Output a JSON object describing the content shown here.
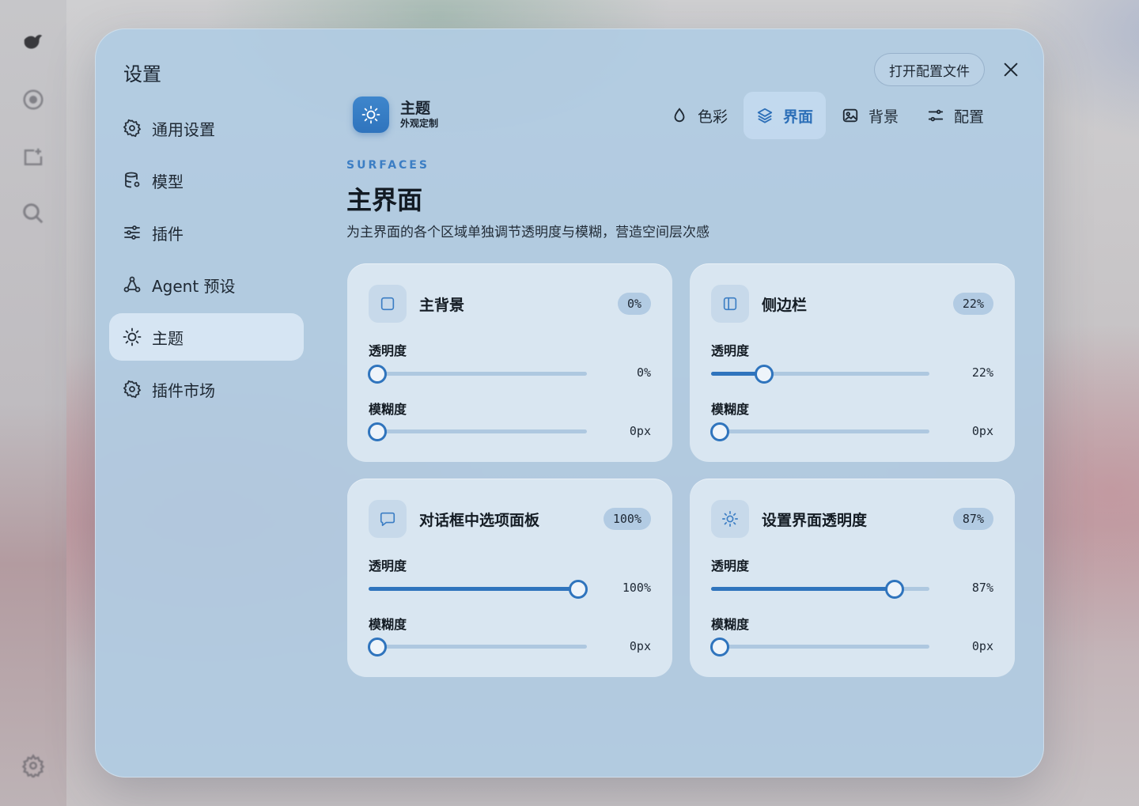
{
  "rail": {
    "icons": [
      "app-logo-icon",
      "record-icon",
      "new-chat-icon",
      "search-icon",
      "settings-icon"
    ]
  },
  "dialog": {
    "title": "设置",
    "open_config_label": "打开配置文件",
    "close_icon": "close-icon"
  },
  "sidebar": {
    "items": [
      {
        "label": "通用设置",
        "icon": "gear-icon",
        "active": false
      },
      {
        "label": "模型",
        "icon": "database-icon",
        "active": false
      },
      {
        "label": "插件",
        "icon": "sliders-icon",
        "active": false
      },
      {
        "label": "Agent 预设",
        "icon": "agent-icon",
        "active": false
      },
      {
        "label": "主题",
        "icon": "sun-icon",
        "active": true
      },
      {
        "label": "插件市场",
        "icon": "gear-icon",
        "active": false
      }
    ]
  },
  "theme_header": {
    "name": "主题",
    "subtitle": "外观定制"
  },
  "tabs": [
    {
      "label": "色彩",
      "icon": "droplet-icon",
      "active": false
    },
    {
      "label": "界面",
      "icon": "layers-icon",
      "active": true
    },
    {
      "label": "背景",
      "icon": "image-icon",
      "active": false
    },
    {
      "label": "配置",
      "icon": "sliders-icon",
      "active": false
    }
  ],
  "section": {
    "eyebrow": "SURFACES",
    "title": "主界面",
    "description": "为主界面的各个区域单独调节透明度与模糊，营造空间层次感"
  },
  "cards": [
    {
      "title": "主背景",
      "icon": "square-icon",
      "badge": "0%",
      "opacity_label": "透明度",
      "opacity_value": "0%",
      "opacity_fraction": 0.0,
      "blur_label": "模糊度",
      "blur_value": "0px",
      "blur_fraction": 0.0
    },
    {
      "title": "侧边栏",
      "icon": "sidebar-icon",
      "badge": "22%",
      "opacity_label": "透明度",
      "opacity_value": "22%",
      "opacity_fraction": 0.22,
      "blur_label": "模糊度",
      "blur_value": "0px",
      "blur_fraction": 0.0
    },
    {
      "title": "对话框中选项面板",
      "icon": "chat-bubble-icon",
      "badge": "100%",
      "opacity_label": "透明度",
      "opacity_value": "100%",
      "opacity_fraction": 1.0,
      "blur_label": "模糊度",
      "blur_value": "0px",
      "blur_fraction": 0.0
    },
    {
      "title": "设置界面透明度",
      "icon": "sun-icon",
      "badge": "87%",
      "opacity_label": "透明度",
      "opacity_value": "87%",
      "opacity_fraction": 0.87,
      "blur_label": "模糊度",
      "blur_value": "0px",
      "blur_fraction": 0.0
    }
  ],
  "colors": {
    "accent": "#2f74bd",
    "dialog_bg": "#b0cbe2",
    "card_bg": "#dde9f3",
    "track": "#aec8e0"
  }
}
